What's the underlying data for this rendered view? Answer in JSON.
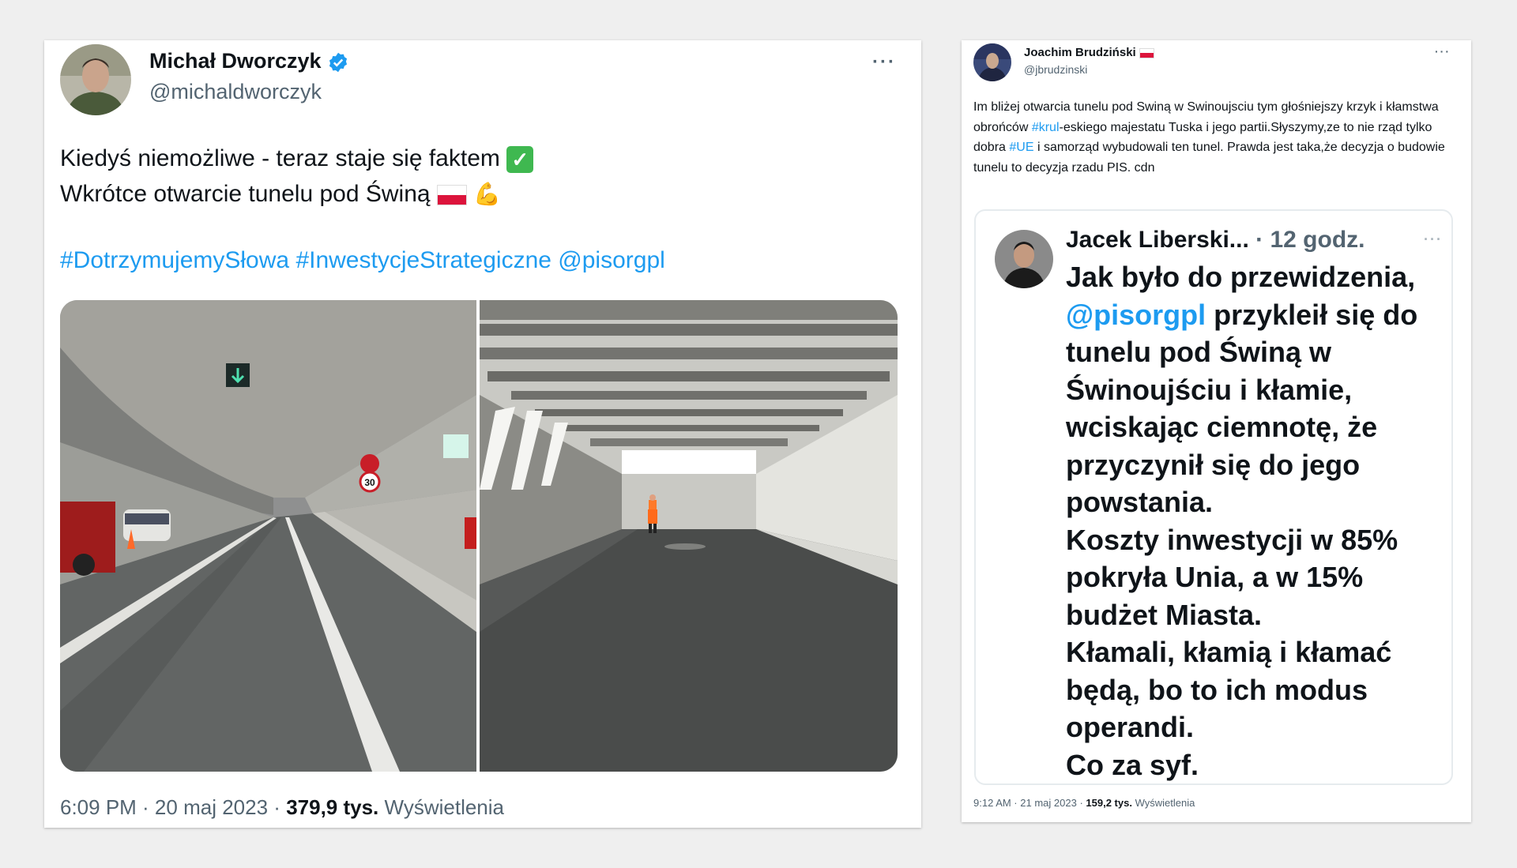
{
  "tweet1": {
    "author_name": "Michał Dworczyk",
    "author_handle": "@michaldworczyk",
    "line1": "Kiedyś niemożliwe - teraz staje się faktem",
    "line2": "Wkrótce otwarcie tunelu pod Świną",
    "check_emoji": "✓",
    "flex_emoji": "💪",
    "tags": [
      "#DotrzymujemySłowa",
      "#InwestycjeStrategiczne",
      "@pisorgpl"
    ],
    "time": "6:09 PM · 20 maj 2023",
    "dot": "·",
    "views_count": "379,9 tys.",
    "views_label": "Wyświetlenia",
    "more": "···",
    "sign_speed": "30"
  },
  "tweet2": {
    "author_name": "Joachim Brudziński",
    "author_handle": "@jbrudzinski",
    "text": {
      "p1": "Im bliżej otwarcia tunelu pod Swiną w Swinoujsciu tym głośniejszy krzyk i kłamstwa obrońców ",
      "tag1": "#krul",
      "p2": "-eskiego majestatu Tuska i jego partii.Słyszymy,ze to nie rząd tylko dobra ",
      "tag2": "#UE",
      "p3": " i samorząd wybudowali ten tunel. Prawda jest taka,że decyzja o budowie tunelu to decyzja rzadu PIS. cdn"
    },
    "time": "9:12 AM · 21 maj 2023",
    "dot": "·",
    "views_count": "159,2 tys.",
    "views_label": "Wyświetlenia",
    "more": "···"
  },
  "quoted": {
    "author_name": "Jacek Liberski...",
    "time": "· 12 godz.",
    "more": "···",
    "line1": "Jak było do przewidzenia,",
    "mention": "@pisorgpl",
    "line2_rest": " przykleił się do",
    "line3": "tunelu pod Świną w",
    "line4": "Świnoujściu i kłamie,",
    "line5": "wciskając ciemnotę, że",
    "line6": "przyczynił się do jego",
    "line7": "powstania.",
    "line8": "Koszty inwestycji w 85%",
    "line9": "pokryła Unia, a w 15%",
    "line10": "budżet Miasta.",
    "line11": "Kłamali, kłamią i kłamać",
    "line12": "będą, bo to ich modus",
    "line13": "operandi.",
    "line14": "Co za syf."
  },
  "colors": {
    "link": "#1d9bf0",
    "verified": "#1d9bf0",
    "check_green": "#3fb850",
    "flag_red": "#dc143c"
  }
}
